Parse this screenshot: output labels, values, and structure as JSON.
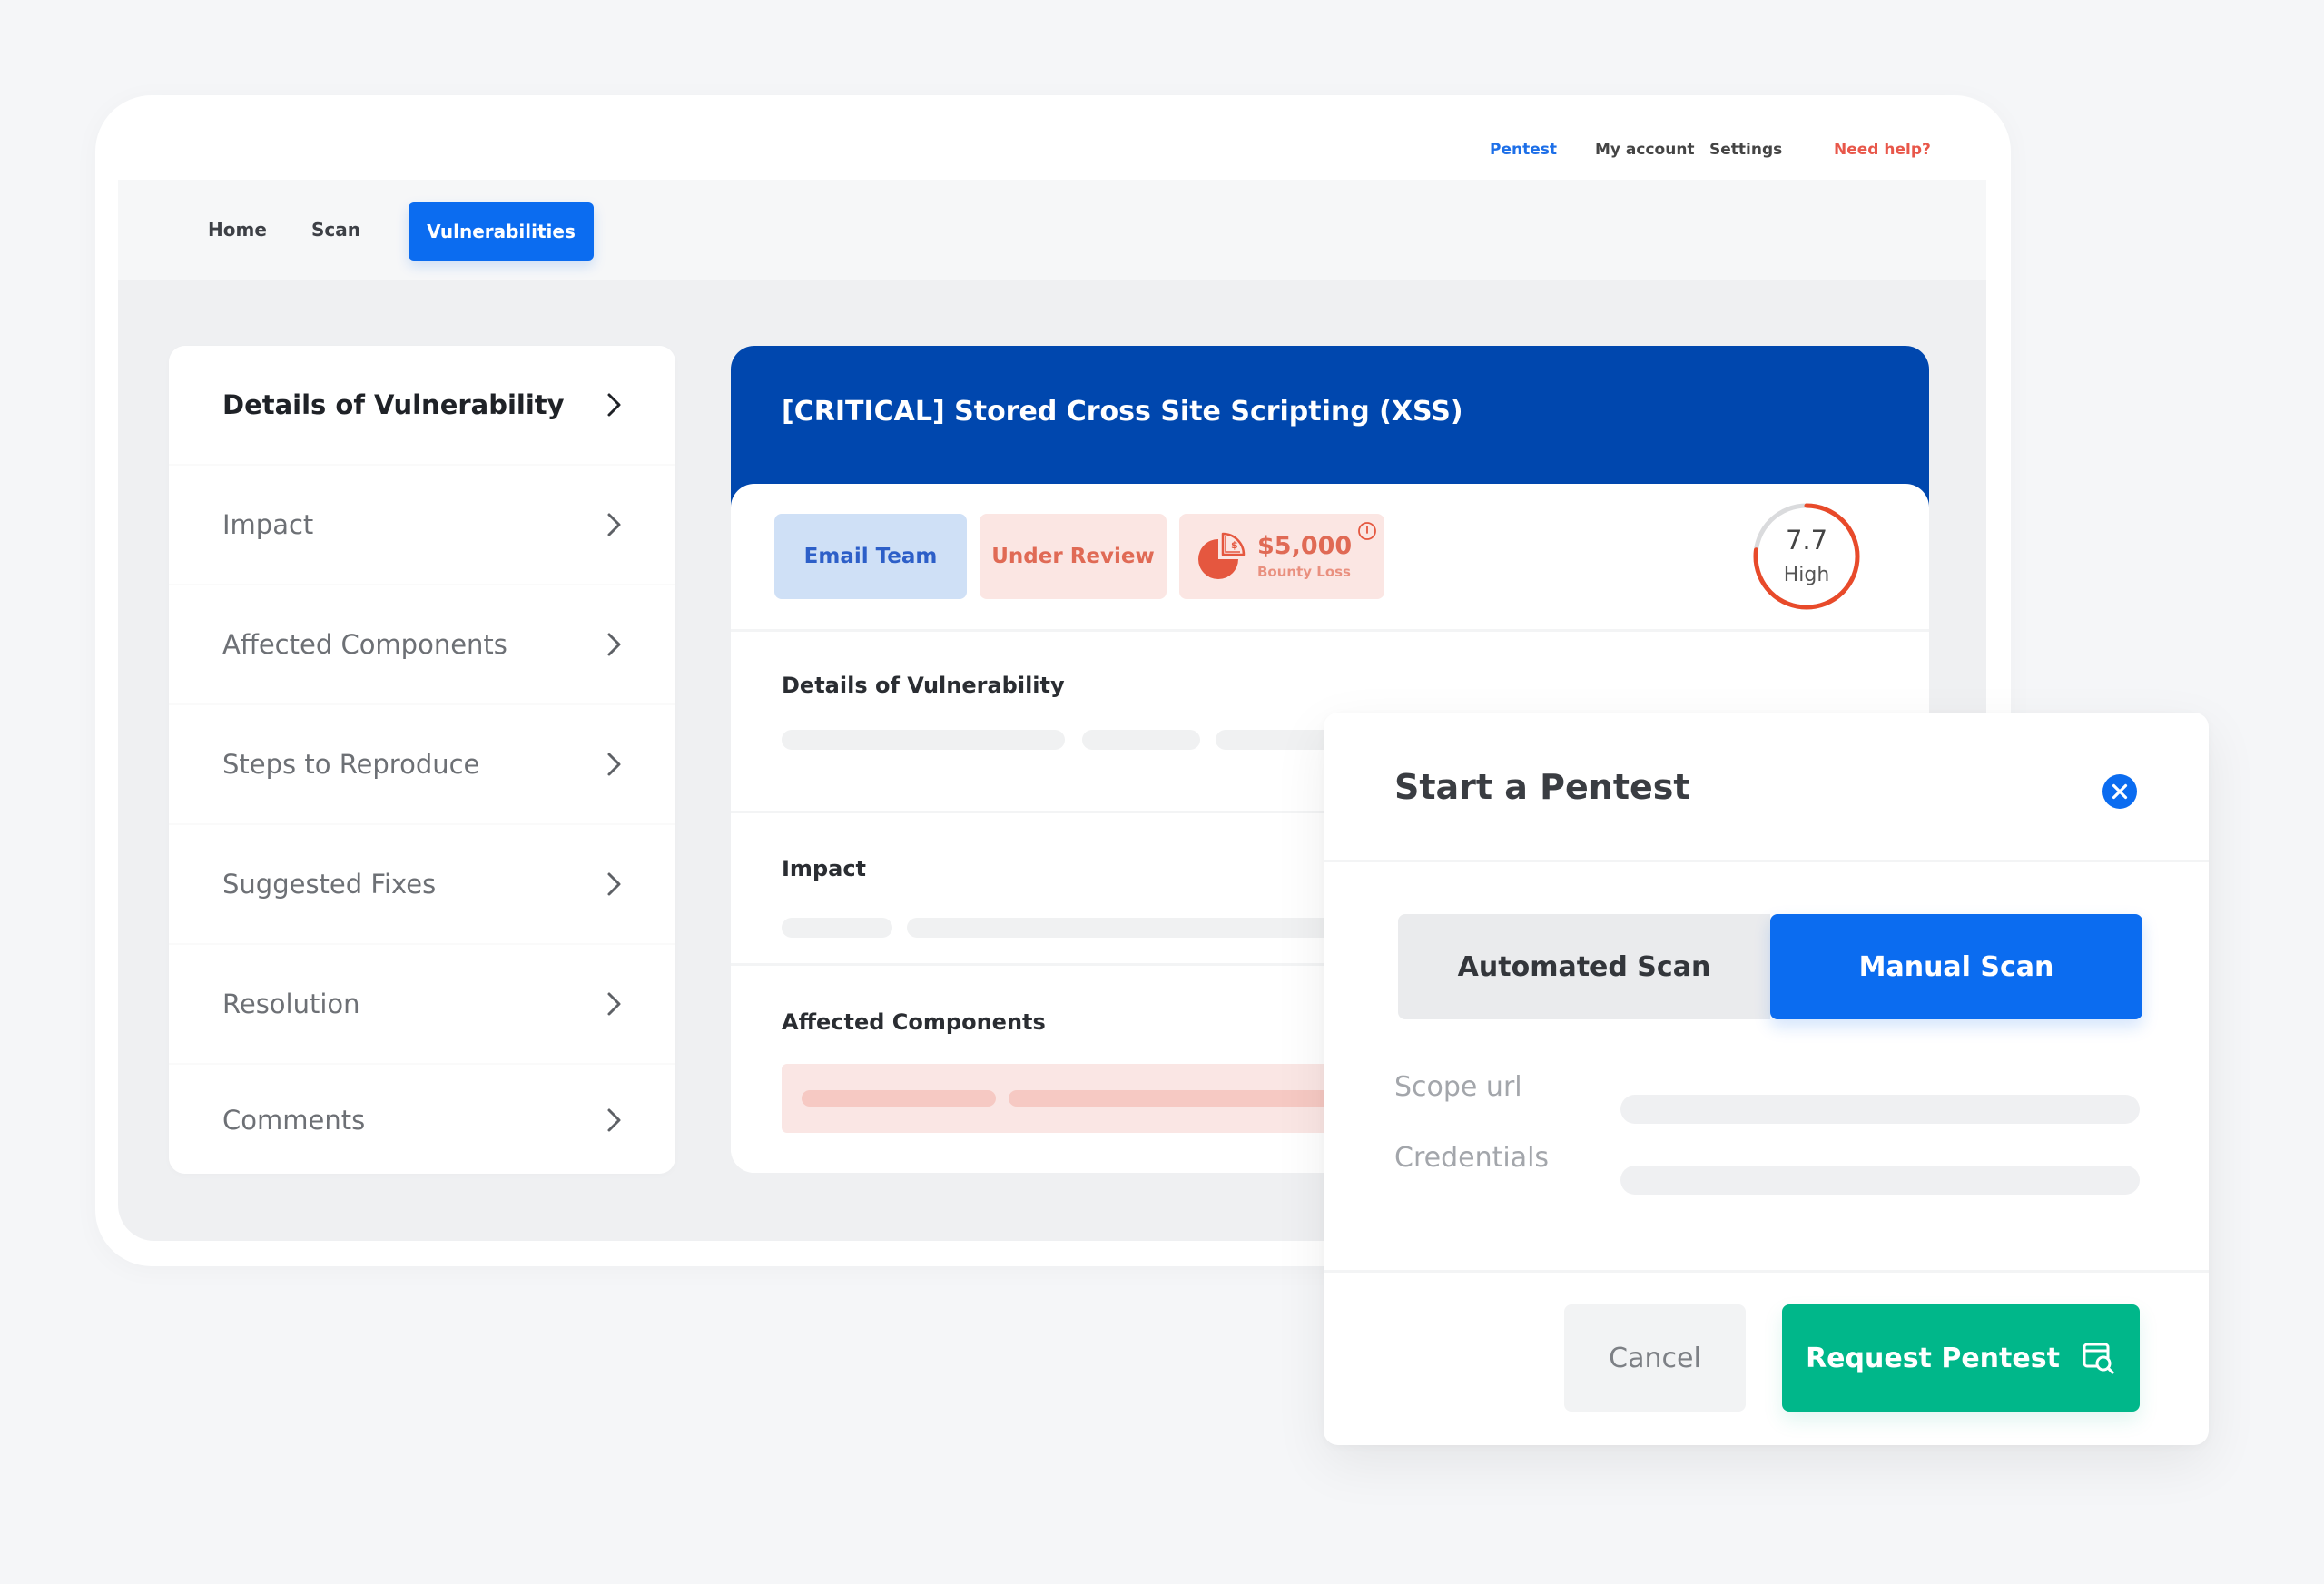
{
  "top_nav": {
    "items": [
      {
        "label": "Pentest",
        "active": true
      },
      {
        "label": "My account"
      },
      {
        "label": "Settings"
      }
    ],
    "help_label": "Need help?"
  },
  "tabs": [
    {
      "label": "Home"
    },
    {
      "label": "Scan"
    },
    {
      "label": "Vulnerabilities",
      "active": true
    }
  ],
  "sidebar": {
    "items": [
      {
        "label": "Details of Vulnerability",
        "active": true,
        "icon": "chevron-right-icon"
      },
      {
        "label": "Impact",
        "icon": "chevron-right-icon"
      },
      {
        "label": "Affected Components",
        "icon": "chevron-right-icon"
      },
      {
        "label": "Steps to Reproduce",
        "icon": "chevron-right-icon"
      },
      {
        "label": "Suggested Fixes",
        "icon": "chevron-right-icon"
      },
      {
        "label": "Resolution",
        "icon": "chevron-right-icon"
      },
      {
        "label": "Comments",
        "icon": "chevron-right-icon"
      }
    ]
  },
  "vulnerability": {
    "title": "[CRITICAL] Stored Cross Site Scripting (XSS)",
    "actions": {
      "email_team": "Email Team",
      "status": "Under Review"
    },
    "bounty": {
      "amount": "$5,000",
      "label": "Bounty Loss",
      "icon": "pie-chart-dollar-icon",
      "info_icon": "info-icon"
    },
    "score": {
      "value": "7.7",
      "label": "High",
      "max": 10,
      "fill_fraction": 0.77
    },
    "sections": [
      {
        "title": "Details of Vulnerability"
      },
      {
        "title": "Impact"
      },
      {
        "title": "Affected Components"
      }
    ]
  },
  "modal": {
    "title": "Start a Pentest",
    "close_icon": "close-icon",
    "scan_types": [
      {
        "label": "Automated Scan",
        "selected": false
      },
      {
        "label": "Manual Scan",
        "selected": true
      }
    ],
    "fields": [
      {
        "label": "Scope url",
        "value": ""
      },
      {
        "label": "Credentials",
        "value": ""
      }
    ],
    "cancel_label": "Cancel",
    "submit_label": "Request Pentest",
    "submit_icon": "browser-search-icon"
  },
  "colors": {
    "brand_blue": "#0b6cf0",
    "header_blue": "#0047ae",
    "danger": "#e8574a",
    "success": "#00b78a"
  }
}
